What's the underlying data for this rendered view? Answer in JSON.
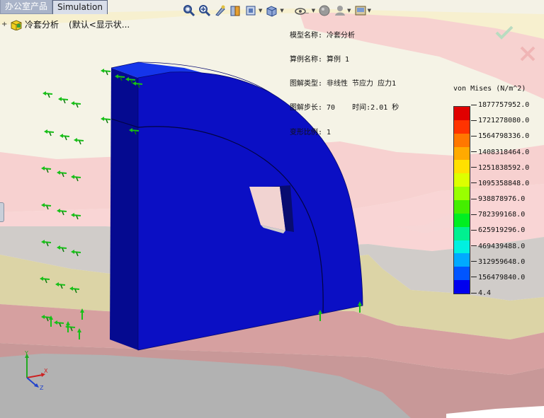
{
  "tabs": [
    {
      "label": "办公室产品",
      "active": false
    },
    {
      "label": "Simulation",
      "active": true
    }
  ],
  "toolbar": {
    "icons": [
      "zoom-to-fit-icon",
      "zoom-to-area-icon",
      "previous-view-icon",
      "section-view-icon",
      "view-orientation-icon",
      "display-style-icon",
      "hide-show-items-icon",
      "edit-appearance-icon",
      "apply-scene-icon",
      "view-settings-icon"
    ]
  },
  "tree": {
    "expander": "+",
    "study_name": "冷套分析",
    "configuration": "(默认<显示状..."
  },
  "plot_info": {
    "lines": [
      "模型名称: 冷套分析",
      "算例名称: 算例 1",
      "图解类型: 非线性 节应力 应力1",
      "图解步长: 70    时间:2.01 秒",
      "变形比例: 1"
    ]
  },
  "legend": {
    "title": "von Mises (N/m^2)",
    "labels": [
      "1877757952.0",
      "1721278080.0",
      "1564798336.0",
      "1408318464.0",
      "1251838592.0",
      "1095358848.0",
      "938878976.0",
      "782399168.0",
      "625919296.0",
      "469439488.0",
      "312959648.0",
      "156479840.0",
      "4.4"
    ],
    "colors": [
      "#e00000",
      "#ff3300",
      "#ff7700",
      "#ffaa00",
      "#ffe000",
      "#ddff00",
      "#99ff00",
      "#44ee00",
      "#00ee22",
      "#00f090",
      "#00f0e0",
      "#00aaff",
      "#0055ff",
      "#0000ee"
    ]
  },
  "colors": {
    "model_front": "#0b0fc4",
    "model_side": "#050a90",
    "model_top": "#1535ea",
    "fixture_arrow": "#18c018",
    "ok_check": "#b9dcc0",
    "cancel_x": "#f0b5b5"
  },
  "triad": {
    "x_label": "X",
    "y_label": "Y",
    "z_label": "Z"
  }
}
